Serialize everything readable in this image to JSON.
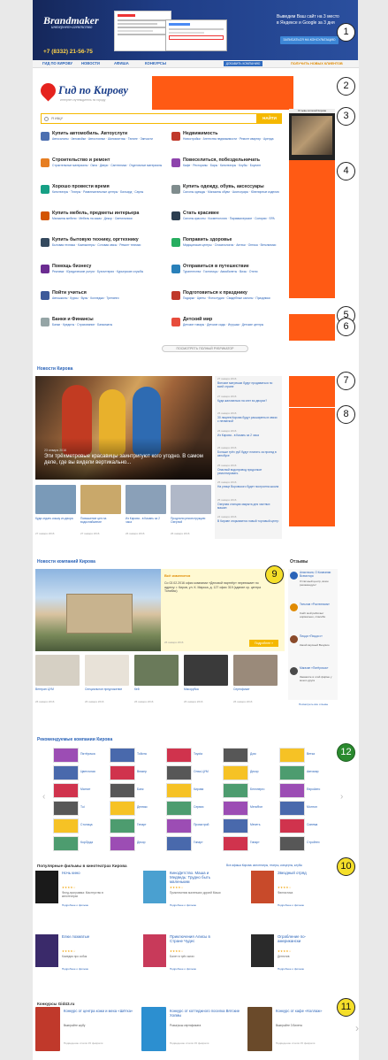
{
  "banner": {
    "brand": "Brandmaker",
    "brand_sub": "интернет-агентство",
    "phone": "+7 (8332) 21-56-75",
    "promo": [
      "Выведем Ваш сайт на 3 место",
      "в Яндексе и Google за 3 дня"
    ],
    "cta": "ЗАПИСАТЬСЯ НА КОНСУЛЬТАЦИЮ"
  },
  "nav": {
    "items": [
      "ГИД ПО КИРОВУ",
      "НОВОСТИ",
      "АФИША",
      "КОНКУРСЫ"
    ],
    "add_company": "ДОБАВИТЬ КОМПАНИЮ",
    "get_clients": "ПОЛУЧИТЬ НОВЫХ КЛИЕНТОВ"
  },
  "logo": {
    "title": "Гид по Кирову",
    "subtitle": "интернет-путеводитель по городу"
  },
  "search": {
    "placeholder": "Я ИЩУ",
    "button": "НАЙТИ"
  },
  "reviews_widget_title": "Отзывы жителей Кирова",
  "categories": [
    {
      "title": "Купить автомобиль. Автоуслуги",
      "links": "Автосалоны · Автомойки · Автостоянки · Шиномонтаж · Тюнинг · Запчасти",
      "color": "#4c6fb0"
    },
    {
      "title": "Недвижимость",
      "links": "Новостройки · Агентства недвижимости · Ремонт квартир · Аренда",
      "color": "#c0392b"
    },
    {
      "title": "Строительство и ремонт",
      "links": "Строительные материалы · Окна · Двери · Сантехника · Отделочные материалы",
      "color": "#e67e22"
    },
    {
      "title": "Повеселиться, побездельничать",
      "links": "Кафе · Рестораны · Бары · Кинотеатры · Клубы · Боулинг",
      "color": "#8e44ad"
    },
    {
      "title": "Хорошо провести время",
      "links": "Кинотеатры · Театры · Развлекательные центры · Бильярд · Сауны",
      "color": "#16a085"
    },
    {
      "title": "Купить одежду, обувь, аксессуары",
      "links": "Салоны одежды · Магазины обуви · Аксессуары · Ювелирные изделия",
      "color": "#7f8c8d"
    },
    {
      "title": "Купить мебель, предметы интерьера",
      "links": "Магазины мебели · Мебель на заказ · Декор · Светильники",
      "color": "#d35400"
    },
    {
      "title": "Стать красивее",
      "links": "Салоны красоты · Косметология · Парикмахерские · Солярии · SPA",
      "color": "#2c3e50"
    },
    {
      "title": "Купить бытовую технику, оргтехнику",
      "links": "Бытовая техника · Компьютеры · Сотовая связь · Ремонт техники",
      "color": "#34495e"
    },
    {
      "title": "Поправить здоровье",
      "links": "Медицинские центры · Стоматология · Аптеки · Оптика · Ветклиники",
      "color": "#27ae60"
    },
    {
      "title": "Помощь бизнесу",
      "links": "Реклама · Юридические услуги · Бухгалтерия · Курьерские службы",
      "color": "#6b2c91"
    },
    {
      "title": "Отправиться в путешествие",
      "links": "Турагентства · Гостиницы · Авиабилеты · Визы · Отели",
      "color": "#2980b9"
    },
    {
      "title": "Пойти учиться",
      "links": "Автошколы · Курсы · Вузы · Колледжи · Тренинги",
      "color": "#3d5a99"
    },
    {
      "title": "Подготовиться к празднику",
      "links": "Подарки · Цветы · Фотостудии · Свадебные салоны · Праздники",
      "color": "#c0392b"
    },
    {
      "title": "Банки и Финансы",
      "links": "Банки · Кредиты · Страхование · Банкоматы",
      "color": "#95a5a6"
    },
    {
      "title": "Детский мир",
      "links": "Детские товары · Детские сады · Игрушки · Детские центры",
      "color": "#e74c3c"
    }
  ],
  "rubricator_btn": "ПОСМОТРЕТЬ ПОЛНЫЙ РУБРИКАТОР",
  "news": {
    "heading": "Новости Кирова",
    "main_date": "23 января 2016",
    "main_title": "Эти трёхметровые красавицы заинтригуют кого угодно. В самом деле, где вы видели вертикально...",
    "side": [
      {
        "date": "27 января 2016",
        "text": "Вятские матрешки будут продаваться по всей стране"
      },
      {
        "date": "27 января 2016",
        "text": "Куда жаловаться на снег во дворах?"
      },
      {
        "date": "26 января 2016",
        "text": "30 лицеев Кирова будут расширены в связи с нехваткой"
      },
      {
        "date": "26 января 2016",
        "text": "Из Кирова - в Казань за 2 часа"
      },
      {
        "date": "26 января 2016",
        "text": "Больше трёх руб будут платить за проезд в автобусе"
      },
      {
        "date": "25 января 2016",
        "text": "Опасный водопровод продолжат ремонтировать"
      },
      {
        "date": "25 января 2016",
        "text": "На улице Воровского будет построена школа"
      },
      {
        "date": "25 января 2016",
        "text": "Озерная станция закрыта для частных машин"
      },
      {
        "date": "24 января 2016",
        "text": "В Кирове открывается новый торговый центр"
      }
    ],
    "thumbs": [
      {
        "title": "Куда отдать кошку из двора",
        "date": "27 января 2016"
      },
      {
        "title": "Повышение цен на водоснабжение",
        "date": "27 января 2016"
      },
      {
        "title": "Из Кирова - в Казань за 2 часа",
        "date": "26 января 2016"
      },
      {
        "title": "Продлили реконструкцию Озерной",
        "date": "26 января 2016"
      }
    ]
  },
  "company_news": {
    "heading": "Новости компаний Кирова",
    "featured_tag": "Всё изменится",
    "featured_text": "Со 02.02.2016 офис компании «Деловой партнёр» переезжает по адресу: г. Киров, ул. К. Маркса, д. 127 офис 319 (здание ср. центра Тонибас)",
    "featured_date": "26 января 2016",
    "details_btn": "Подробнее »",
    "thumbs": [
      {
        "title": "Ветеран ЦУМ",
        "date": "26 января 2016"
      },
      {
        "title": "Специальное предложение",
        "date": "26 января 2016"
      },
      {
        "title": "Кей",
        "date": "26 января 2016"
      },
      {
        "title": "Мясорубка",
        "date": "26 января 2016"
      },
      {
        "title": "Сертификат",
        "date": "26 января 2016"
      }
    ]
  },
  "reviews": {
    "heading": "Отзывы",
    "items": [
      {
        "name": "Анастасия, О Компании Всемоторс",
        "text": "Отличный центр, всем рекомендую!"
      },
      {
        "name": "Тельнов «Ростелеком»",
        "text": "Сайт мой работает нормально, спасибо"
      },
      {
        "name": "Пицца «Пицца с»",
        "text": "Какой вкусный Везувио"
      },
      {
        "name": "Магазин «Пятёрочка»",
        "text": "Закажите в этой фирме у моего друга"
      }
    ],
    "all": "Посмотреть все отзывы"
  },
  "recommended": {
    "heading": "Рекомендуемые компании Кирова",
    "col1": [
      "Пятёрочка",
      "Цветочная",
      "Магнит",
      "Tui",
      "Столица",
      "КорОрда"
    ],
    "col2": [
      "Тойота",
      "Веккер",
      "Банк",
      "Делюкс",
      "Гепарт",
      "Декор"
    ],
    "col3": [
      "Toyota",
      "Олха-ЦУМ",
      "Кирова",
      "Сервис",
      "Промстрой",
      "Гипарт"
    ],
    "col4": [
      "Дом",
      "Декор",
      "Белэнерго",
      "МегаФон",
      "Мечеть",
      "Гипарт"
    ],
    "col5": [
      "Ветка",
      "Автомир",
      "ЕвроАвто",
      "Монтон",
      "Синема",
      "Стройтех"
    ]
  },
  "films": {
    "heading": "Популярные фильмы в кинотеатрах Кирова",
    "links": "Все афиша Кирова: кинотеатры, театры, концерты, клубы",
    "items": [
      {
        "title": "Ночь кино",
        "desc": "Фонд-программа: Мастерство в кинотеатрах"
      },
      {
        "title": "КиноДетство. Маша и Медведь: Трудно быть маленьким",
        "desc": "Приключения маленьких друзей Маши"
      },
      {
        "title": "Звездный отряд",
        "desc": "Фантастика"
      },
      {
        "title": "Елки лохматые",
        "desc": "Комедия про собак"
      },
      {
        "title": "Приключения Алисы в Стране Чудес",
        "desc": "Балет в трёх актах"
      },
      {
        "title": "Ограбление по-американски",
        "desc": "Детектив"
      }
    ],
    "more": "Подробнее о фильме"
  },
  "contests": {
    "heading": "Конкурсы Gid43.ru",
    "items": [
      {
        "title": "Конкурс от центра кожи и меха «Шётка»",
        "desc": "Выиграйте шубу"
      },
      {
        "title": "Конкурс от коттеджного поселка Вятские Холмы",
        "desc": "Розыгрыш сертификата"
      },
      {
        "title": "Конкурс от кафе «Коллаж»",
        "desc": "Выиграйте 3 билета"
      }
    ],
    "date": "Подведение итогов 15 февраля"
  },
  "markers": [
    "1",
    "2",
    "3",
    "4",
    "5",
    "6",
    "7",
    "8",
    "9",
    "12",
    "10",
    "11"
  ],
  "colors": {
    "accent": "#ff5a14",
    "brand_blue": "#1a3e8a",
    "yellow": "#f5b800",
    "link": "#2a63b8"
  }
}
